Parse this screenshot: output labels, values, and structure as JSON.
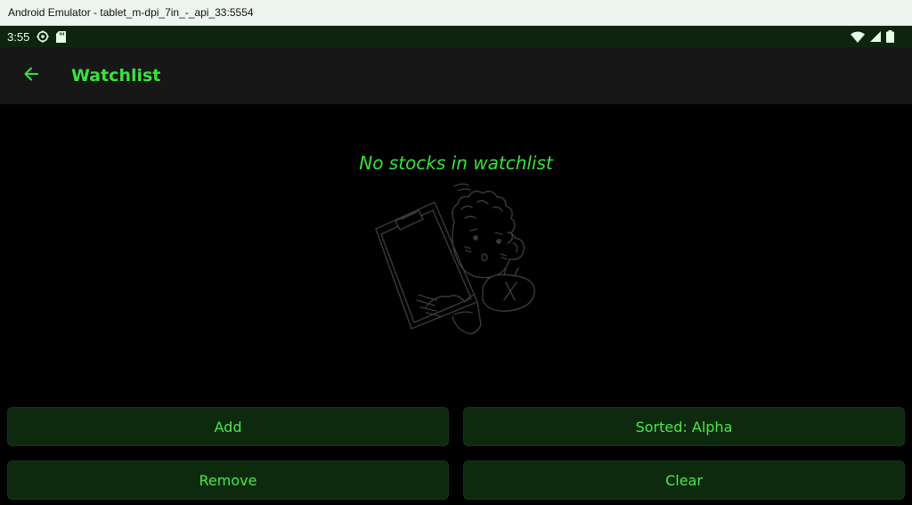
{
  "window": {
    "title": "Android Emulator - tablet_m-dpi_7in_-_api_33:5554"
  },
  "status_bar": {
    "time": "3:55",
    "icons": [
      "settings-gear-icon",
      "sd-card-icon",
      "wifi-icon",
      "cell-signal-icon",
      "battery-icon"
    ]
  },
  "app_bar": {
    "back_icon": "arrow-left-icon",
    "title": "Watchlist"
  },
  "main": {
    "empty_message": "No stocks in watchlist",
    "illustration": "person-holding-clipboard-illustration"
  },
  "actions": {
    "add_label": "Add",
    "sort_label": "Sorted: Alpha",
    "remove_label": "Remove",
    "clear_label": "Clear"
  },
  "colors": {
    "accent": "#39e23c",
    "button_bg": "#0e2a0e",
    "appbar_bg": "#171717",
    "statusbar_bg": "#0e240e",
    "background": "#000000"
  }
}
